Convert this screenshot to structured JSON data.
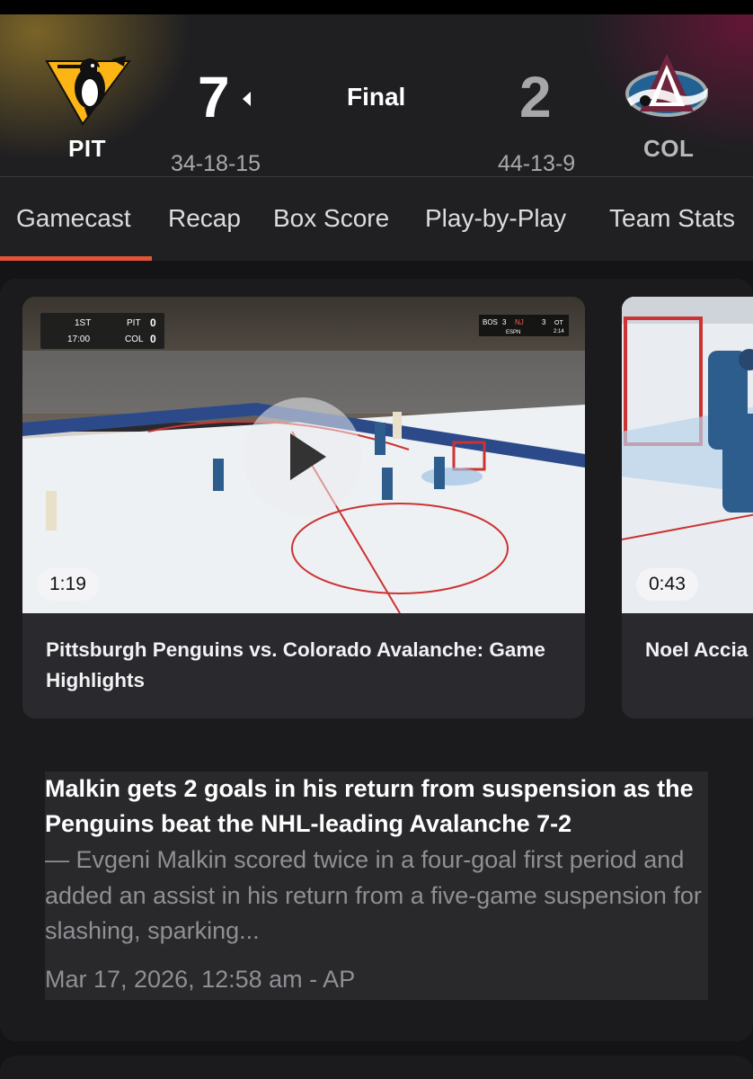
{
  "game": {
    "status": "Final",
    "home": {
      "abbr": "PIT",
      "score": "7",
      "record": "34-18-15"
    },
    "away": {
      "abbr": "COL",
      "score": "2",
      "record": "44-13-9"
    }
  },
  "tabs": [
    "Gamecast",
    "Recap",
    "Box Score",
    "Play-by-Play",
    "Team Stats"
  ],
  "videos": [
    {
      "title": "Pittsburgh Penguins vs. Colorado Avalanche: Game Highlights",
      "duration": "1:19",
      "scorebug": {
        "period": "1ST",
        "clock": "17:00",
        "team1": "PIT",
        "score1": "0",
        "team2": "COL",
        "score2": "0"
      },
      "ticker": {
        "t1": "BOS",
        "s1": "3",
        "t2": "NJ",
        "s2": "3",
        "period": "OT",
        "clock": "2:14",
        "network": "ESPN"
      }
    },
    {
      "title": "Noel Accia",
      "duration": "0:43"
    }
  ],
  "story": {
    "headline": "Malkin gets 2 goals in his return from suspension as the Penguins beat the NHL-leading Avalanche 7-2",
    "snippet": "— Evgeni Malkin scored twice in a four-goal first period and added an assist in his return from a five-game suspension for slashing, sparking...",
    "meta": "Mar 17, 2026, 12:58 am - AP"
  },
  "colors": {
    "accent": "#e5533a",
    "pit_gold": "#fcb514",
    "col_blue": "#236192",
    "col_burgundy": "#6f263d"
  },
  "icons": {
    "winner": "left-triangle-icon",
    "play": "play-icon"
  }
}
